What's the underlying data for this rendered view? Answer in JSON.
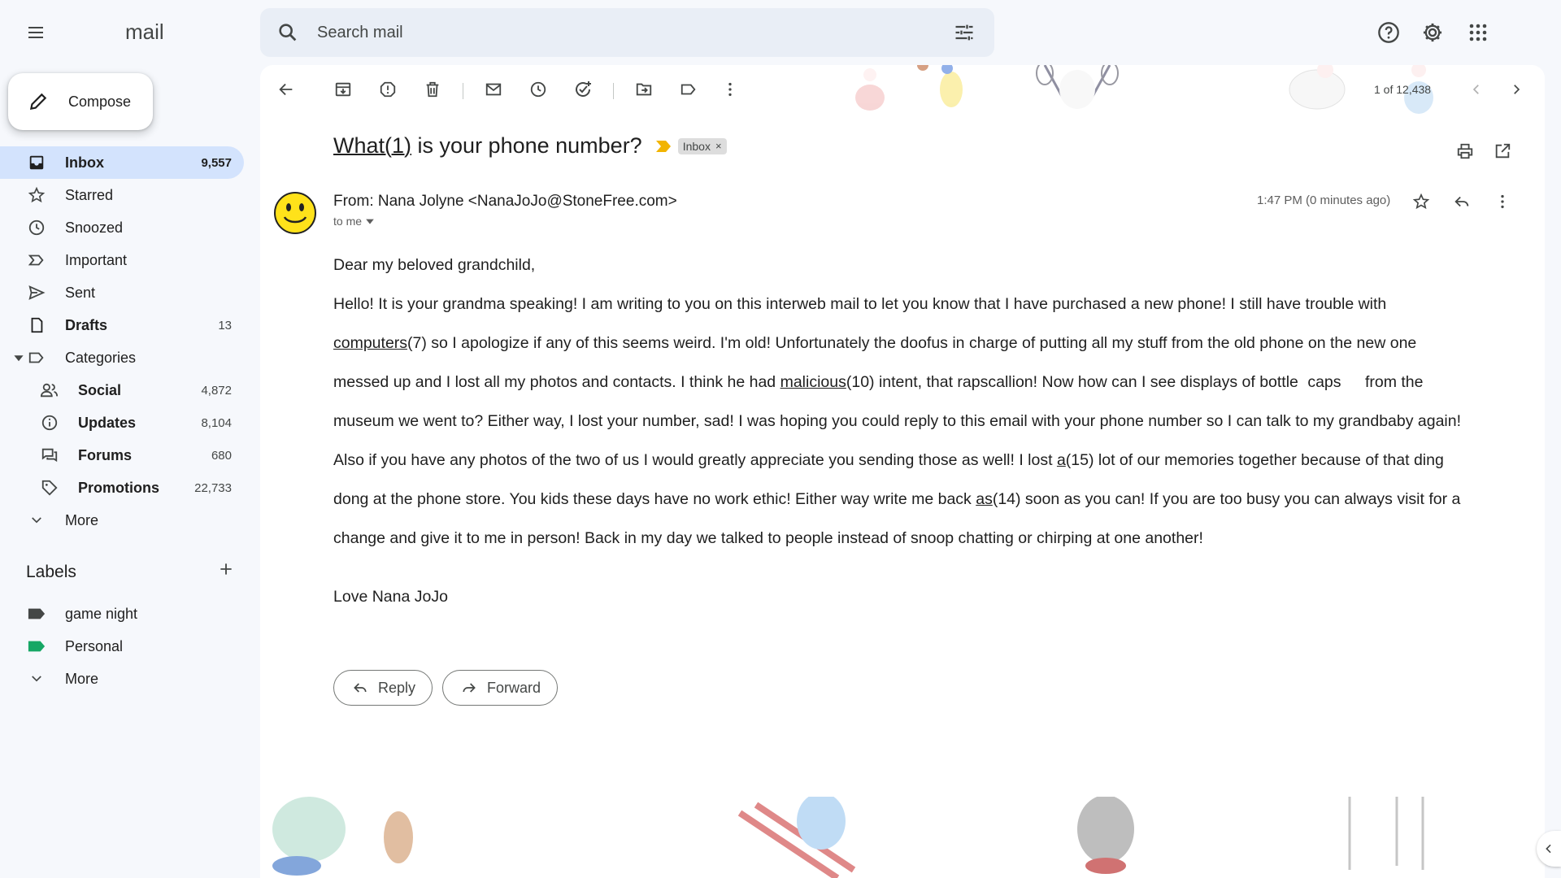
{
  "app": {
    "logo": "mail"
  },
  "search": {
    "placeholder": "Search mail"
  },
  "compose": {
    "label": "Compose"
  },
  "sidebar": {
    "items": [
      {
        "label": "Inbox",
        "count": "9,557"
      },
      {
        "label": "Starred",
        "count": ""
      },
      {
        "label": "Snoozed",
        "count": ""
      },
      {
        "label": "Important",
        "count": ""
      },
      {
        "label": "Sent",
        "count": ""
      },
      {
        "label": "Drafts",
        "count": "13"
      },
      {
        "label": "Categories",
        "count": ""
      }
    ],
    "categories": [
      {
        "label": "Social",
        "count": "4,872"
      },
      {
        "label": "Updates",
        "count": "8,104"
      },
      {
        "label": "Forums",
        "count": "680"
      },
      {
        "label": "Promotions",
        "count": "22,733"
      }
    ],
    "more": "More",
    "labels_title": "Labels",
    "labels": [
      {
        "label": "game night",
        "color": "#444746"
      },
      {
        "label": "Personal",
        "color": "#16a765"
      }
    ],
    "labels_more": "More"
  },
  "toolbar": {
    "pager": "1 of 12,438"
  },
  "email": {
    "subject_underlined": "What(1)",
    "subject_rest": " is your phone number?",
    "chip": "Inbox",
    "chip_close": "×",
    "from": "From: Nana Jolyne <NanaJoJo@StoneFree.com>",
    "to": "to me",
    "time": "1:47 PM (0 minutes ago)",
    "greeting": "Dear my beloved grandchild,",
    "p1_a": "Hello! It is your grandma speaking! I am writing to you on this interweb mail to let you know that I have purchased a new phone! I still have trouble with ",
    "p1_u1": "computers",
    "p1_b": "(7) so I apologize if any of this seems weird. I'm old!  Unfortunately the doofus in charge of putting all my stuff from the old phone on the new one messed up and I lost all my photos and contacts. I think he had ",
    "p1_u2": "malicious",
    "p1_c": "(10) intent, that rapscallion! Now how can I see displays of bottle ",
    "p1_caps": "caps",
    "p1_d": " from the museum we went to?  Either way, I lost your number, sad! I was hoping you could reply to this email with your phone number so I can talk to my grandbaby again! Also if you have any photos of the two of us I would greatly appreciate you sending those as well! I lost ",
    "p1_u3": "a",
    "p1_e": "(15) lot of our memories together because of that ding dong at the phone store. You kids these days have no work ethic! Either way write me back ",
    "p1_u4": "as",
    "p1_f": "(14) soon as you can! If you are too busy you can always visit for a change and give it to me in person! Back in my day we talked to people instead of snoop chatting or chirping at one another!",
    "signoff": "Love Nana JoJo"
  },
  "actions": {
    "reply": "Reply",
    "forward": "Forward"
  },
  "icons": {
    "menu": "hamburger-icon",
    "search": "search-icon",
    "tune": "tune-icon",
    "help": "help-icon",
    "settings": "gear-icon",
    "apps": "apps-grid-icon"
  },
  "colors": {
    "accent": "#d3e3fd",
    "background": "#f6f8fc",
    "important": "#f2b400",
    "personal_label": "#16a765"
  }
}
